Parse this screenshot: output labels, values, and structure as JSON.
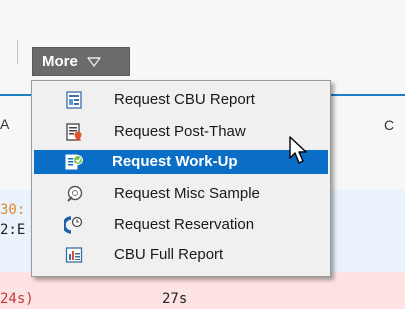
{
  "toolbar": {
    "more_label": "More"
  },
  "menu": {
    "items": [
      {
        "label": "Request CBU Report",
        "icon": "cbu-report-icon"
      },
      {
        "label": "Request Post-Thaw",
        "icon": "post-thaw-icon"
      },
      {
        "label": "Request Work-Up",
        "icon": "work-up-icon",
        "selected": true
      },
      {
        "label": "Request Misc Sample",
        "icon": "misc-sample-icon"
      },
      {
        "label": "Request Reservation",
        "icon": "reservation-icon"
      },
      {
        "label": "CBU Full Report",
        "icon": "full-report-icon"
      }
    ]
  },
  "background": {
    "header_left": "A",
    "header_right": "C",
    "row1_text": "30:",
    "row2_text": "2:E",
    "row3_text": "24s)",
    "row3_value": "27s"
  },
  "colors": {
    "selection": "#0a6ec6",
    "header_line": "#1f7dc3"
  }
}
